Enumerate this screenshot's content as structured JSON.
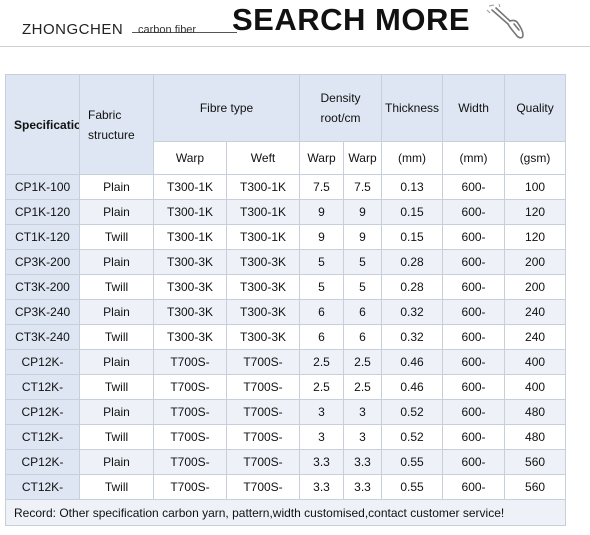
{
  "banner": {
    "brand": "ZHONGCHEN",
    "brand_sub": "carbon fiber",
    "search_more": "SEARCH MORE",
    "icon": "pointing-hand-icon"
  },
  "table": {
    "headers": {
      "specification": "Specification",
      "fabric_structure": "Fabric structure",
      "fibre_type": "Fibre type",
      "density": "Density root/cm",
      "thickness": "Thickness",
      "width": "Width",
      "quality": "Quality",
      "warp": "Warp",
      "weft": "Weft",
      "density_warp": "Warp",
      "density_weft": "Warp",
      "thickness_unit": "(mm)",
      "width_unit": "(mm)",
      "quality_unit": "(gsm)"
    },
    "rows": [
      {
        "spec": "CP1K-100",
        "structure": "Plain",
        "warp": "T300-1K",
        "weft": "T300-1K",
        "d1": "7.5",
        "d2": "7.5",
        "thickness": "0.13",
        "width": "600-",
        "quality": "100"
      },
      {
        "spec": "CP1K-120",
        "structure": "Plain",
        "warp": "T300-1K",
        "weft": "T300-1K",
        "d1": "9",
        "d2": "9",
        "thickness": "0.15",
        "width": "600-",
        "quality": "120"
      },
      {
        "spec": "CT1K-120",
        "structure": "Twill",
        "warp": "T300-1K",
        "weft": "T300-1K",
        "d1": "9",
        "d2": "9",
        "thickness": "0.15",
        "width": "600-",
        "quality": "120"
      },
      {
        "spec": "CP3K-200",
        "structure": "Plain",
        "warp": "T300-3K",
        "weft": "T300-3K",
        "d1": "5",
        "d2": "5",
        "thickness": "0.28",
        "width": "600-",
        "quality": "200"
      },
      {
        "spec": "CT3K-200",
        "structure": "Twill",
        "warp": "T300-3K",
        "weft": "T300-3K",
        "d1": "5",
        "d2": "5",
        "thickness": "0.28",
        "width": "600-",
        "quality": "200"
      },
      {
        "spec": "CP3K-240",
        "structure": "Plain",
        "warp": "T300-3K",
        "weft": "T300-3K",
        "d1": "6",
        "d2": "6",
        "thickness": "0.32",
        "width": "600-",
        "quality": "240"
      },
      {
        "spec": "CT3K-240",
        "structure": "Twill",
        "warp": "T300-3K",
        "weft": "T300-3K",
        "d1": "6",
        "d2": "6",
        "thickness": "0.32",
        "width": "600-",
        "quality": "240"
      },
      {
        "spec": "CP12K-",
        "structure": "Plain",
        "warp": "T700S-",
        "weft": "T700S-",
        "d1": "2.5",
        "d2": "2.5",
        "thickness": "0.46",
        "width": "600-",
        "quality": "400"
      },
      {
        "spec": "CT12K-",
        "structure": "Twill",
        "warp": "T700S-",
        "weft": "T700S-",
        "d1": "2.5",
        "d2": "2.5",
        "thickness": "0.46",
        "width": "600-",
        "quality": "400"
      },
      {
        "spec": "CP12K-",
        "structure": "Plain",
        "warp": "T700S-",
        "weft": "T700S-",
        "d1": "3",
        "d2": "3",
        "thickness": "0.52",
        "width": "600-",
        "quality": "480"
      },
      {
        "spec": "CT12K-",
        "structure": "Twill",
        "warp": "T700S-",
        "weft": "T700S-",
        "d1": "3",
        "d2": "3",
        "thickness": "0.52",
        "width": "600-",
        "quality": "480"
      },
      {
        "spec": "CP12K-",
        "structure": "Plain",
        "warp": "T700S-",
        "weft": "T700S-",
        "d1": "3.3",
        "d2": "3.3",
        "thickness": "0.55",
        "width": "600-",
        "quality": "560"
      },
      {
        "spec": "CT12K-",
        "structure": "Twill",
        "warp": "T700S-",
        "weft": "T700S-",
        "d1": "3.3",
        "d2": "3.3",
        "thickness": "0.55",
        "width": "600-",
        "quality": "560"
      }
    ],
    "record": "Record: Other specification carbon yarn, pattern,width customised,contact customer service!"
  },
  "colors": {
    "header_bg": "#dde6f2",
    "alt_row_bg": "#eef2f8",
    "border": "#c6cfda"
  }
}
